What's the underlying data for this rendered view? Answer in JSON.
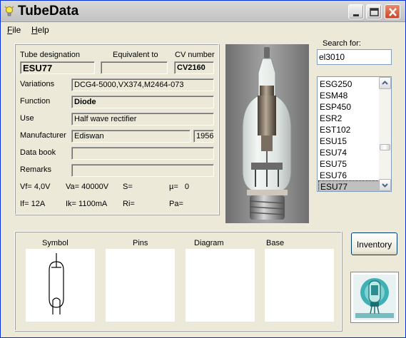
{
  "window": {
    "title": "TubeData"
  },
  "menu": {
    "file": "File",
    "help": "Help"
  },
  "details": {
    "tube_designation_label": "Tube designation",
    "equivalent_to_label": "Equivalent to",
    "cv_number_label": "CV number",
    "tube_designation": "ESU77",
    "equivalent_to": "",
    "cv_number": "CV2160",
    "variations_label": "Variations",
    "variations": "DCG4-5000,VX374,M2464-073",
    "function_label": "Function",
    "function": "Diode",
    "use_label": "Use",
    "use": "Half wave rectifier",
    "manufacturer_label": "Manufacturer",
    "manufacturer": "Ediswan",
    "year": "1956",
    "data_book_label": "Data book",
    "data_book": "",
    "remarks_label": "Remarks",
    "remarks": "",
    "vf": "Vf= 4,0V",
    "va": "Va= 40000V",
    "s": "S=",
    "mu": "µ=   0",
    "if": "If= 12A",
    "ik": "Ik= 1100mA",
    "ri": "Ri=",
    "pa": "Pa="
  },
  "search": {
    "label": "Search for:",
    "value": "el3010"
  },
  "tube_list": {
    "items": [
      "ESG250",
      "ESM48",
      "ESP450",
      "ESR2",
      "EST102",
      "ESU15",
      "ESU74",
      "ESU75",
      "ESU76",
      "ESU77"
    ],
    "selected": "ESU77"
  },
  "bottom": {
    "symbol_label": "Symbol",
    "pins_label": "Pins",
    "diagram_label": "Diagram",
    "base_label": "Base"
  },
  "inventory_button": "Inventory"
}
